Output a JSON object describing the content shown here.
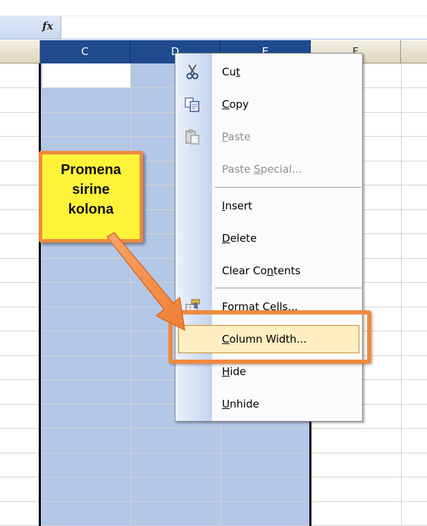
{
  "formula_bar": {
    "fx_label": "fx",
    "value": ""
  },
  "columns": [
    {
      "label": "C",
      "selected": true
    },
    {
      "label": "D",
      "selected": true
    },
    {
      "label": "E",
      "selected": true
    },
    {
      "label": "F",
      "selected": false
    }
  ],
  "context_menu": {
    "items": [
      {
        "label": "Cut",
        "underline_char": "t",
        "icon": "scissors-icon",
        "enabled": true
      },
      {
        "label": "Copy",
        "underline_char": "C",
        "icon": "copy-icon",
        "enabled": true
      },
      {
        "label": "Paste",
        "underline_char": "P",
        "icon": "paste-icon",
        "enabled": false
      },
      {
        "label": "Paste Special...",
        "underline_char": "S",
        "icon": "",
        "enabled": false
      },
      {
        "label": "Insert",
        "underline_char": "I",
        "icon": "",
        "enabled": true
      },
      {
        "label": "Delete",
        "underline_char": "D",
        "icon": "",
        "enabled": true
      },
      {
        "label": "Clear Contents",
        "underline_char": "n",
        "icon": "",
        "enabled": true
      },
      {
        "label": "Format Cells...",
        "underline_char": "F",
        "icon": "format-cells-icon",
        "enabled": true
      },
      {
        "label": "Column Width...",
        "underline_char": "C",
        "icon": "",
        "enabled": true,
        "highlighted": true
      },
      {
        "label": "Hide",
        "underline_char": "H",
        "icon": "",
        "enabled": true
      },
      {
        "label": "Unhide",
        "underline_char": "U",
        "icon": "",
        "enabled": true
      }
    ]
  },
  "annotation": {
    "text": "Promena\nsirine\nkolona"
  },
  "colors": {
    "accent_orange": "#f08a3e",
    "callout_yellow": "#fff33a",
    "selection_blue": "#b3c7e6",
    "header_selected": "#1f4a8e",
    "menu_highlight": "#ffeec2"
  }
}
